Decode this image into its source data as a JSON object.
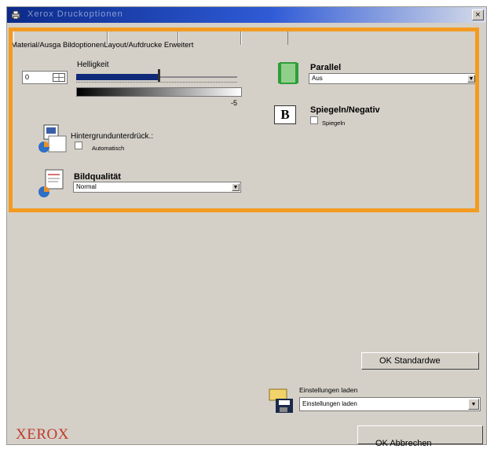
{
  "window": {
    "title": "Xerox Druckoptionen",
    "close_glyph": "×"
  },
  "tabs": {
    "label_row": "Material/Ausga BildoptionenLayout/Aufdrucke Erweitert"
  },
  "brightness": {
    "label": "Helligkeit",
    "value": "0",
    "scale_mark": "-5",
    "level_percent": 50
  },
  "background": {
    "label": "Hintergrundunterdrück.:",
    "checkbox_label": "Automatisch"
  },
  "quality": {
    "label": "Bildqualität",
    "selected": "Normal"
  },
  "parallel": {
    "label": "Parallel",
    "selected": "Aus"
  },
  "mirror": {
    "label": "Spiegeln/Negativ",
    "letter": "B",
    "checkbox_label": "Spiegeln"
  },
  "buttons": {
    "standard": "OK Standardwe",
    "ok_cancel": "OK Abbrechen"
  },
  "settings": {
    "label": "Einstellungen laden",
    "selected": "Einstellungen laden"
  },
  "brand": {
    "logo_text": "XEROX"
  },
  "colors": {
    "highlight": "#f39b20",
    "slider": "#102a7a",
    "parallel_icon": "#2e9d3a",
    "logo": "#c0392b"
  }
}
